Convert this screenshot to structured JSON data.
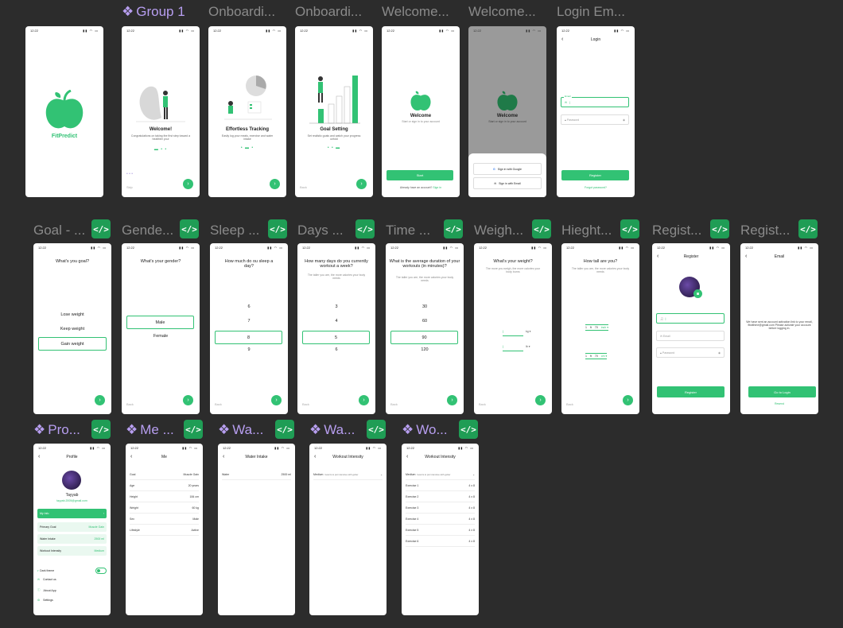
{
  "frame_labels": {
    "group1": "Group 1",
    "onboard1": "Onboardi...",
    "onboard2": "Onboardi...",
    "welcome1": "Welcome...",
    "welcome2": "Welcome...",
    "login": "Login Em...",
    "goal": "Goal - ...",
    "gender": "Gende...",
    "sleep": "Sleep ...",
    "days": "Days ...",
    "time": "Time ...",
    "weight": "Weigh...",
    "height": "Hieght...",
    "reg1": "Regist...",
    "reg2": "Regist...",
    "profile": "Pro...",
    "me": "Me ...",
    "water": "Wa...",
    "workout": "Wa...",
    "wo": "Wo..."
  },
  "code_badge": "</>",
  "status": {
    "time": "12:22",
    "icons": "▮▮ ◠ ▭"
  },
  "splash": {
    "brand": "FitPredict"
  },
  "onboard1": {
    "title": "Welcome!",
    "desc": "Congratulations on taking the first step toward a healthier you!",
    "skip": "Skip"
  },
  "onboard2": {
    "title": "Effortless Tracking",
    "desc": "Easily log your meals, exercise and water intake"
  },
  "onboard3": {
    "title": "Goal Setting",
    "desc": "Set realistic goals and watch your progress unfold",
    "back": "Back"
  },
  "welcome": {
    "title": "Welcome",
    "sub": "Start or sign in to your account",
    "start": "Start",
    "already": "Already have an account?",
    "signin": "Sign in"
  },
  "welcome2": {
    "google": "Sign in with Google",
    "email": "Sign in with Email"
  },
  "login": {
    "title": "Login",
    "email_label": "Email",
    "password": "Password",
    "register": "Register",
    "forgot": "Forgot password?"
  },
  "goal": {
    "q": "What's you goal?",
    "opts": [
      "Lose weight",
      "Keep weight",
      "Gain weight"
    ]
  },
  "gender": {
    "q": "What's your gender?",
    "opts": [
      "Male",
      "Female"
    ],
    "back": "Back"
  },
  "sleep": {
    "q": "How much do ou sleep a day?",
    "opts": [
      "6",
      "7",
      "8",
      "9"
    ]
  },
  "days": {
    "q": "How many days do you currently workout a week?",
    "sub": "The taller you are, the more calories your body needs",
    "opts": [
      "3",
      "4",
      "5",
      "6"
    ]
  },
  "time": {
    "q": "What is the average duration of your workouts (in minutes)?",
    "sub": "The taller you are, the more calories your body needs",
    "opts": [
      "30",
      "60",
      "90",
      "120"
    ]
  },
  "weight": {
    "q": "What's your weight?",
    "sub": "The more you weigh, the more calories your body burns",
    "unit1": "kg ▾",
    "unit2": "lb ▾"
  },
  "height": {
    "q": "How tall are you?",
    "sub": "The taller you are, the more calories your body needs",
    "r1": [
      "1",
      "ft",
      "70",
      "inch ▾"
    ],
    "r2": [
      "1",
      "ft",
      "70",
      "cm ▾"
    ]
  },
  "register": {
    "title": "Register",
    "email": "Email",
    "password": "Password",
    "btn": "Register"
  },
  "email_page": {
    "title": "Email",
    "msg": "We have sent an account activation link to your email, fitwithme@gmail.com Please activate your account before logging in.",
    "btn": "Go to Login",
    "resend": "Resend"
  },
  "profile": {
    "title": "Profile",
    "name": "Tayyab",
    "email": "tayyab.2005@gmail.com",
    "my_info": "My Info",
    "rows": [
      [
        "Primary Goal",
        "Muscle Gain"
      ],
      [
        "Water Intake",
        "2500 ml"
      ],
      [
        "Workout Intensity",
        "Medium"
      ]
    ],
    "settings": [
      "Dark theme",
      "Contact us",
      "About App",
      "Settings"
    ]
  },
  "me": {
    "title": "Me",
    "rows": [
      [
        "Goal",
        "Muscle Gain"
      ],
      [
        "Age",
        "20 years"
      ],
      [
        "Height",
        "184 cm"
      ],
      [
        "Weight",
        "60 kg"
      ],
      [
        "Sex",
        "Male"
      ],
      [
        "Lifestyle",
        "Active"
      ]
    ]
  },
  "water": {
    "title": "Water Intake",
    "label": "Water",
    "value": "2500 ml"
  },
  "wi": {
    "title": "Workout Intensity",
    "level": "Medium",
    "note": "Goal is to put intensive with gutter"
  },
  "wo": {
    "title": "Workout Intensity",
    "level": "Medium",
    "note": "Goal is to put intensive with gutter",
    "exercises": [
      [
        "Exercise 1",
        "4 x 8"
      ],
      [
        "Exercise 2",
        "4 x 8"
      ],
      [
        "Exercise 3",
        "4 x 8"
      ],
      [
        "Exercise 4",
        "4 x 8"
      ],
      [
        "Exercise 5",
        "4 x 8"
      ],
      [
        "Exercise 6",
        "4 x 8"
      ]
    ]
  },
  "colors": {
    "accent": "#32c274",
    "canvas": "#2c2c2c",
    "component": "#b79ef0"
  }
}
